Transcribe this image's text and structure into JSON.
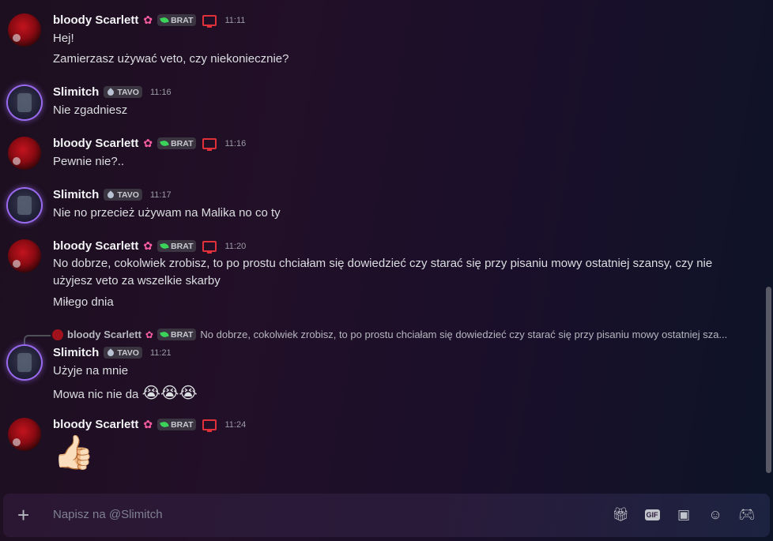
{
  "messages": [
    {
      "author": "bloody Scarlett",
      "tag": "BRAT",
      "time": "11:11",
      "lines": [
        "Hej!",
        "Zamierzasz używać veto, czy niekoniecznie?"
      ]
    },
    {
      "author": "Slimitch",
      "tag": "TAVO",
      "time": "11:16",
      "lines": [
        "Nie zgadniesz"
      ]
    },
    {
      "author": "bloody Scarlett",
      "tag": "BRAT",
      "time": "11:16",
      "lines": [
        "Pewnie nie?.."
      ]
    },
    {
      "author": "Slimitch",
      "tag": "TAVO",
      "time": "11:17",
      "lines": [
        "Nie no przecież używam na Malika no co ty"
      ]
    },
    {
      "author": "bloody Scarlett",
      "tag": "BRAT",
      "time": "11:20",
      "lines": [
        "No dobrze, cokolwiek zrobisz, to po prostu chciałam się dowiedzieć czy starać się przy pisaniu mowy ostatniej szansy, czy nie użyjesz veto za wszelkie skarby",
        "Miłego dnia"
      ]
    },
    {
      "author": "Slimitch",
      "tag": "TAVO",
      "time": "11:21",
      "lines": [
        "Użyje na mnie",
        "Mowa nic nie da"
      ],
      "emoji": "😭😭😭",
      "reply": {
        "author": "bloody Scarlett",
        "tag": "BRAT",
        "text": "No dobrze, cokolwiek zrobisz, to po prostu chciałam się dowiedzieć czy starać się przy pisaniu mowy ostatniej sza..."
      }
    },
    {
      "author": "bloody Scarlett",
      "tag": "BRAT",
      "time": "11:24",
      "emoji": "👍🏻"
    }
  ],
  "composer": {
    "placeholder": "Napisz na @Slimitch",
    "plus": "+",
    "gif_label": "GIF"
  },
  "icons": {
    "gift": "gift-icon",
    "gif": "gif-icon",
    "sticker": "sticker-icon",
    "emoji": "emoji-icon",
    "apps": "gamepad-icon"
  },
  "colors": {
    "name": "#f2f3f5",
    "time": "#9b9ca5",
    "flower": "#ff5fa2",
    "leaf": "#3bd35a",
    "monitor": "#e0303a"
  }
}
